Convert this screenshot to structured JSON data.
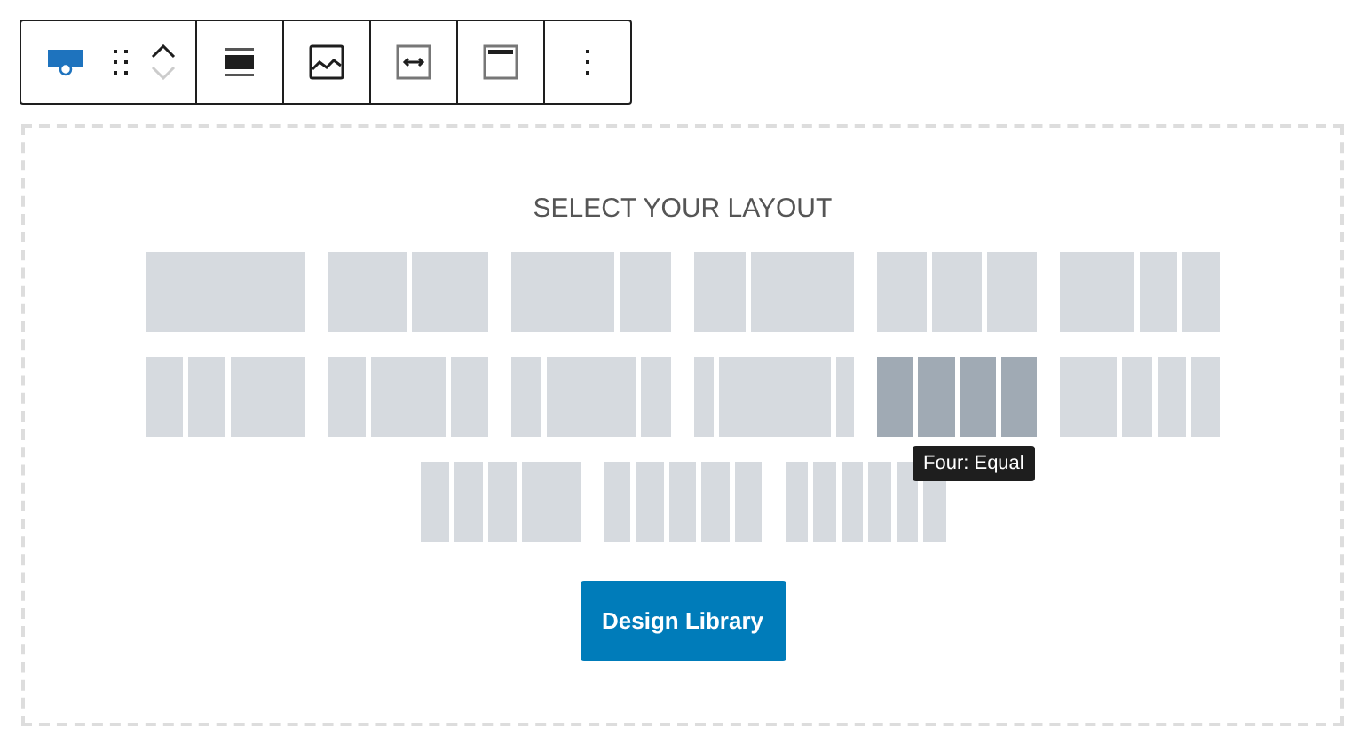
{
  "toolbar": {
    "groups": [
      [
        {
          "kind": "block",
          "selected": true
        },
        {
          "kind": "drag"
        },
        {
          "kind": "mover"
        }
      ],
      [
        {
          "kind": "align"
        }
      ],
      [
        {
          "kind": "image"
        }
      ],
      [
        {
          "kind": "fullwidth"
        }
      ],
      [
        {
          "kind": "header"
        }
      ],
      [
        {
          "kind": "more"
        }
      ]
    ],
    "move_down": {
      "disabled": true
    }
  },
  "placeholder": {
    "title": "SELECT YOUR LAYOUT",
    "rows": [
      [
        {
          "kind": "one",
          "selected": false
        },
        {
          "kind": "half-half",
          "selected": false
        },
        {
          "kind": "wide-narrow",
          "selected": false
        },
        {
          "kind": "narrow-wide",
          "selected": false
        },
        {
          "kind": "three-equal",
          "selected": false
        },
        {
          "kind": "wide-narrow-narrow",
          "selected": false
        }
      ],
      [
        {
          "kind": "narrow-narrow-wide",
          "selected": false
        },
        {
          "kind": "narrow-wide-narrow",
          "selected": false
        },
        {
          "kind": "narrow-wider-narrow",
          "selected": false
        },
        {
          "kind": "thin-widest-thin",
          "selected": false
        },
        {
          "kind": "four-equal",
          "selected": true,
          "tooltip": "Four: Equal"
        },
        {
          "kind": "wide-narrow-narrow-narrow",
          "selected": false
        }
      ],
      [
        {
          "kind": "narrow-narrow-narrow-wide",
          "selected": false
        },
        {
          "kind": "five-equal",
          "selected": false
        },
        {
          "kind": "six-equal",
          "selected": false
        }
      ]
    ],
    "button": "Design Library"
  }
}
